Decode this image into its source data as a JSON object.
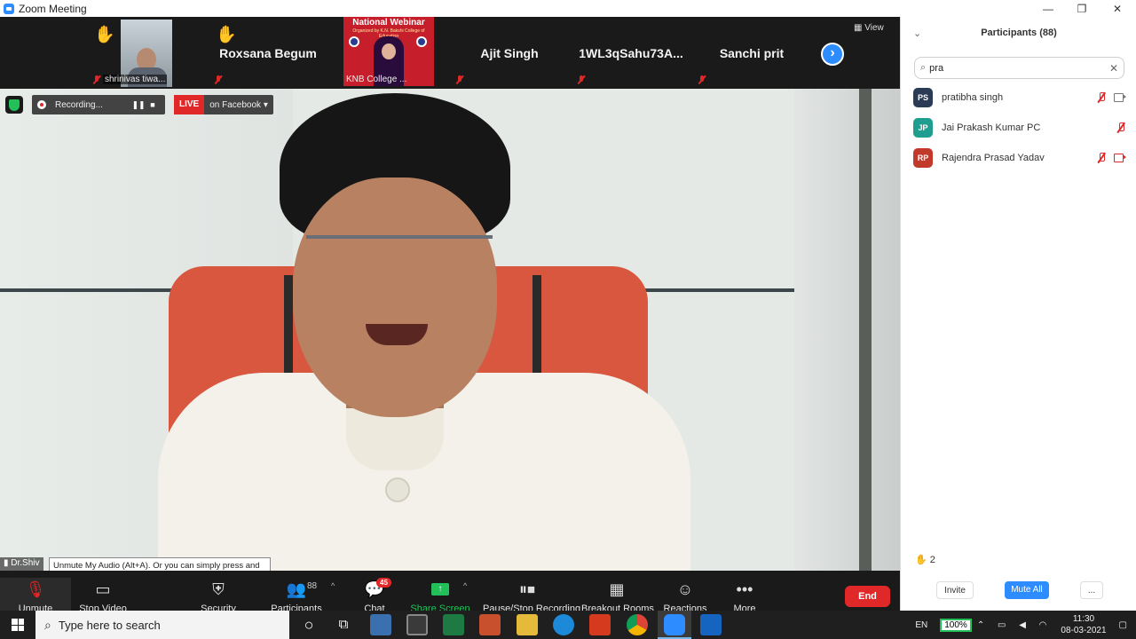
{
  "window": {
    "title": "Zoom Meeting",
    "minimize": "—",
    "maximize": "❐",
    "close": "✕"
  },
  "gallery": {
    "tiles": [
      {
        "label": "shrinivas tiwa..."
      },
      {
        "label": "Roxsana Begum"
      },
      {
        "label": "KNB College ..."
      },
      {
        "label": "Ajit Singh"
      },
      {
        "label": "1WL3qSahu73A..."
      },
      {
        "label": "Sanchi prit"
      }
    ],
    "webinar_title": "National Webinar",
    "webinar_sub": "Organized by K.N. Bakshi College of Education",
    "view_label": "View",
    "next_arrow": "›"
  },
  "recording": {
    "status": "Recording...",
    "pause": "❚❚",
    "stop": "■"
  },
  "live": {
    "badge": "LIVE",
    "destination": "on Facebook ▾"
  },
  "speaker": {
    "name": "Dr.Shiv"
  },
  "tooltip": {
    "text": "Unmute My Audio (Alt+A). Or you can simply press and hold the space bar to temporarily unmute."
  },
  "toolbar": {
    "unmute": "Unmute",
    "stop_video": "Stop Video",
    "security": "Security",
    "participants": "Participants",
    "participants_count": "88",
    "chat": "Chat",
    "chat_badge": "45",
    "share_screen": "Share Screen",
    "pause_stop_recording": "Pause/Stop Recording",
    "breakout_rooms": "Breakout Rooms",
    "reactions": "Reactions",
    "more": "More",
    "end": "End"
  },
  "panel": {
    "title": "Participants (88)",
    "collapse": "⌄",
    "search_value": "pra",
    "clear": "✕",
    "participants": [
      {
        "initials": "PS",
        "name": "pratibha singh",
        "color": "#2b3a55"
      },
      {
        "initials": "JP",
        "name": "Jai Prakash Kumar PC",
        "color": "#1f9e8f"
      },
      {
        "initials": "RP",
        "name": "Rajendra Prasad Yadav",
        "color": "#c0392b"
      }
    ],
    "raised_hands": "2",
    "invite": "Invite",
    "mute_all": "Mute All",
    "more": "..."
  },
  "taskbar": {
    "search_placeholder": "Type here to search",
    "lang": "EN",
    "battery": "100%",
    "time": "11:30",
    "date": "08-03-2021"
  },
  "colors": {
    "accent": "#2d8cff",
    "danger": "#e02828",
    "success": "#23c05a"
  }
}
